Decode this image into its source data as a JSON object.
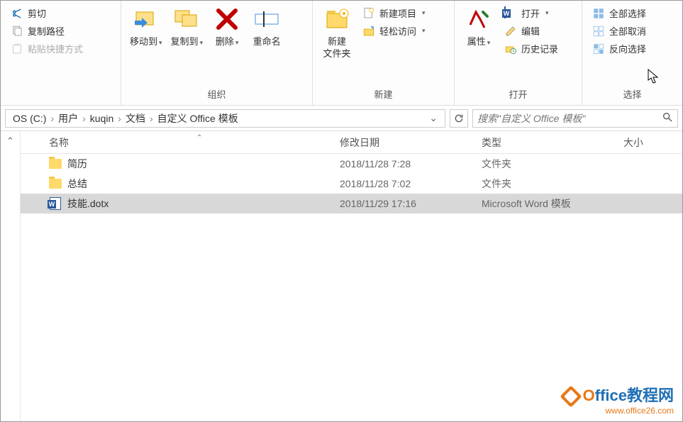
{
  "ribbon": {
    "clipboard": {
      "cut": "剪切",
      "copy_path": "复制路径",
      "paste_shortcut": "粘贴快捷方式",
      "label": ""
    },
    "organize": {
      "move_to": "移动到",
      "copy_to": "复制到",
      "delete": "删除",
      "rename": "重命名",
      "label": "组织"
    },
    "new": {
      "new_folder": "新建\n文件夹",
      "new_item": "新建项目",
      "easy_access": "轻松访问",
      "label": "新建"
    },
    "open": {
      "properties": "属性",
      "open": "打开",
      "edit": "编辑",
      "history": "历史记录",
      "label": "打开"
    },
    "select": {
      "select_all": "全部选择",
      "select_none": "全部取消",
      "invert": "反向选择",
      "label": "选择"
    }
  },
  "breadcrumb": {
    "items": [
      "OS (C:)",
      "用户",
      "kuqin",
      "文档",
      "自定义 Office 模板"
    ]
  },
  "search": {
    "placeholder": "搜索\"自定义 Office 模板\""
  },
  "columns": {
    "name": "名称",
    "date": "修改日期",
    "type": "类型",
    "size": "大小"
  },
  "rows": [
    {
      "name": "简历",
      "date": "2018/11/28 7:28",
      "type": "文件夹",
      "kind": "folder",
      "selected": false
    },
    {
      "name": "总结",
      "date": "2018/11/28 7:02",
      "type": "文件夹",
      "kind": "folder",
      "selected": false
    },
    {
      "name": "技能.dotx",
      "date": "2018/11/29 17:16",
      "type": "Microsoft Word 模板",
      "kind": "word",
      "selected": true
    }
  ],
  "watermark": {
    "title_prefix": "O",
    "title_rest": "ffice教程网",
    "url": "www.office26.com"
  }
}
